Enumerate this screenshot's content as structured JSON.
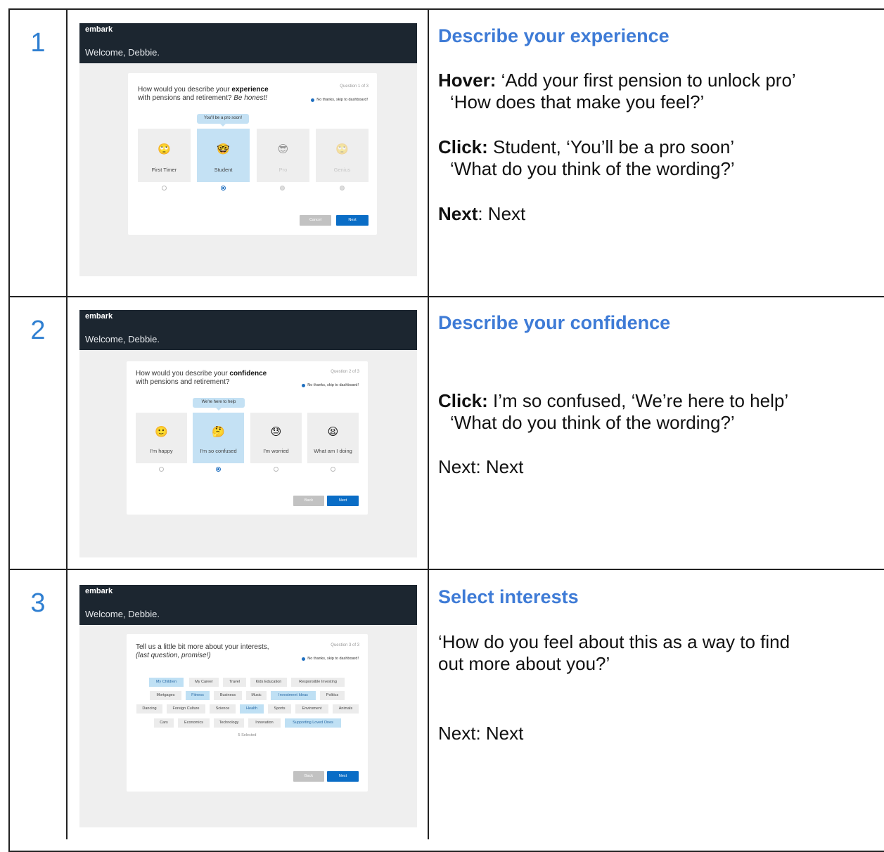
{
  "steps": [
    {
      "number": "1",
      "screen": {
        "brand": "embark",
        "welcome": "Welcome, Debbie.",
        "question_pre": "How would you describe your ",
        "question_bold": "experience",
        "question_line2": "with pensions and retirement? ",
        "question_italic": "Be honest!",
        "counter": "Question 1 of 3",
        "skip": "No thanks, skip to dashboard!",
        "tooltip": "You'll be a pro soon!",
        "options": [
          {
            "label": "First Timer",
            "icon": "rolling-eyes-face-icon",
            "emoji": "🙄",
            "selected": false,
            "dim": false
          },
          {
            "label": "Student",
            "icon": "nerd-face-icon",
            "emoji": "🤓",
            "selected": true,
            "dim": false
          },
          {
            "label": "Pro",
            "icon": "sunglasses-face-icon",
            "emoji": "😎",
            "selected": false,
            "dim": true
          },
          {
            "label": "Genius",
            "icon": "thinking-face-icon",
            "emoji": "🙄",
            "selected": false,
            "dim": true
          }
        ],
        "buttons": {
          "left": "Cancel",
          "right": "Next"
        }
      },
      "notes": {
        "title": "Describe your experience",
        "hover_label": "Hover:",
        "hover_text": "  ‘Add your first pension to unlock pro’",
        "hover_q": "‘How does that make you feel?’",
        "click_label": "Click:",
        "click_text": " Student, ‘You’ll be a pro soon’",
        "click_q": "‘What do you think of the wording?’",
        "next_label": "Next",
        "next_text": ": Next"
      }
    },
    {
      "number": "2",
      "screen": {
        "brand": "embark",
        "welcome": "Welcome, Debbie.",
        "question_pre": "How would you describe your ",
        "question_bold": "confidence",
        "question_line2": "with pensions and retirement?",
        "counter": "Question 2 of 3",
        "skip": "No thanks, skip to dashboard!",
        "tooltip": "We're here to help",
        "options": [
          {
            "label": "I'm happy",
            "icon": "slightly-smiling-face-icon",
            "emoji": "🙂",
            "selected": false
          },
          {
            "label": "I'm so confused",
            "icon": "thinking-face-icon",
            "emoji": "🤔",
            "selected": true
          },
          {
            "label": "I'm worried",
            "icon": "downcast-sweat-face-icon",
            "emoji": "😓",
            "selected": false
          },
          {
            "label": "What am I doing",
            "icon": "tired-face-icon",
            "emoji": "😫",
            "selected": false
          }
        ],
        "buttons": {
          "left": "Back",
          "right": "Next"
        }
      },
      "notes": {
        "title": "Describe your confidence",
        "click_label": "Click:",
        "click_text": " I’m so confused, ‘We’re here to help’",
        "click_q": "‘What do you think of the wording?’",
        "next_text": "Next: Next"
      }
    },
    {
      "number": "3",
      "screen": {
        "brand": "embark",
        "welcome": "Welcome, Debbie.",
        "question_line1": "Tell us a little bit more about your interests,",
        "question_italic": "(last question, promise!)",
        "counter": "Question 3 of 3",
        "skip": "No thanks, skip to dashboard!",
        "interest_rows": [
          [
            {
              "label": "My Children",
              "selected": true
            },
            {
              "label": "My Career",
              "selected": false
            },
            {
              "label": "Travel",
              "selected": false
            },
            {
              "label": "Kids Education",
              "selected": false
            },
            {
              "label": "Responsible Investing",
              "selected": false
            }
          ],
          [
            {
              "label": "Mortgages",
              "selected": false
            },
            {
              "label": "Fitness",
              "selected": true
            },
            {
              "label": "Business",
              "selected": false
            },
            {
              "label": "Music",
              "selected": false
            },
            {
              "label": "Investment Ideas",
              "selected": true
            },
            {
              "label": "Politics",
              "selected": false
            }
          ],
          [
            {
              "label": "Dancing",
              "selected": false
            },
            {
              "label": "Foreign Culture",
              "selected": false
            },
            {
              "label": "Science",
              "selected": false
            },
            {
              "label": "Health",
              "selected": true
            },
            {
              "label": "Sports",
              "selected": false
            },
            {
              "label": "Enviroment",
              "selected": false
            },
            {
              "label": "Animals",
              "selected": false
            }
          ],
          [
            {
              "label": "Cars",
              "selected": false
            },
            {
              "label": "Economics",
              "selected": false
            },
            {
              "label": "Technology",
              "selected": false
            },
            {
              "label": "Innovation",
              "selected": false
            },
            {
              "label": "Supporting Loved Ones",
              "selected": true
            }
          ]
        ],
        "selected_count": "5 Selected",
        "buttons": {
          "left": "Back",
          "right": "Next"
        }
      },
      "notes": {
        "title": "Select interests",
        "q_line1": " ‘How do you feel about this as a way to find",
        "q_line2": "out more about you?’",
        "next_text": "Next: Next"
      }
    }
  ]
}
